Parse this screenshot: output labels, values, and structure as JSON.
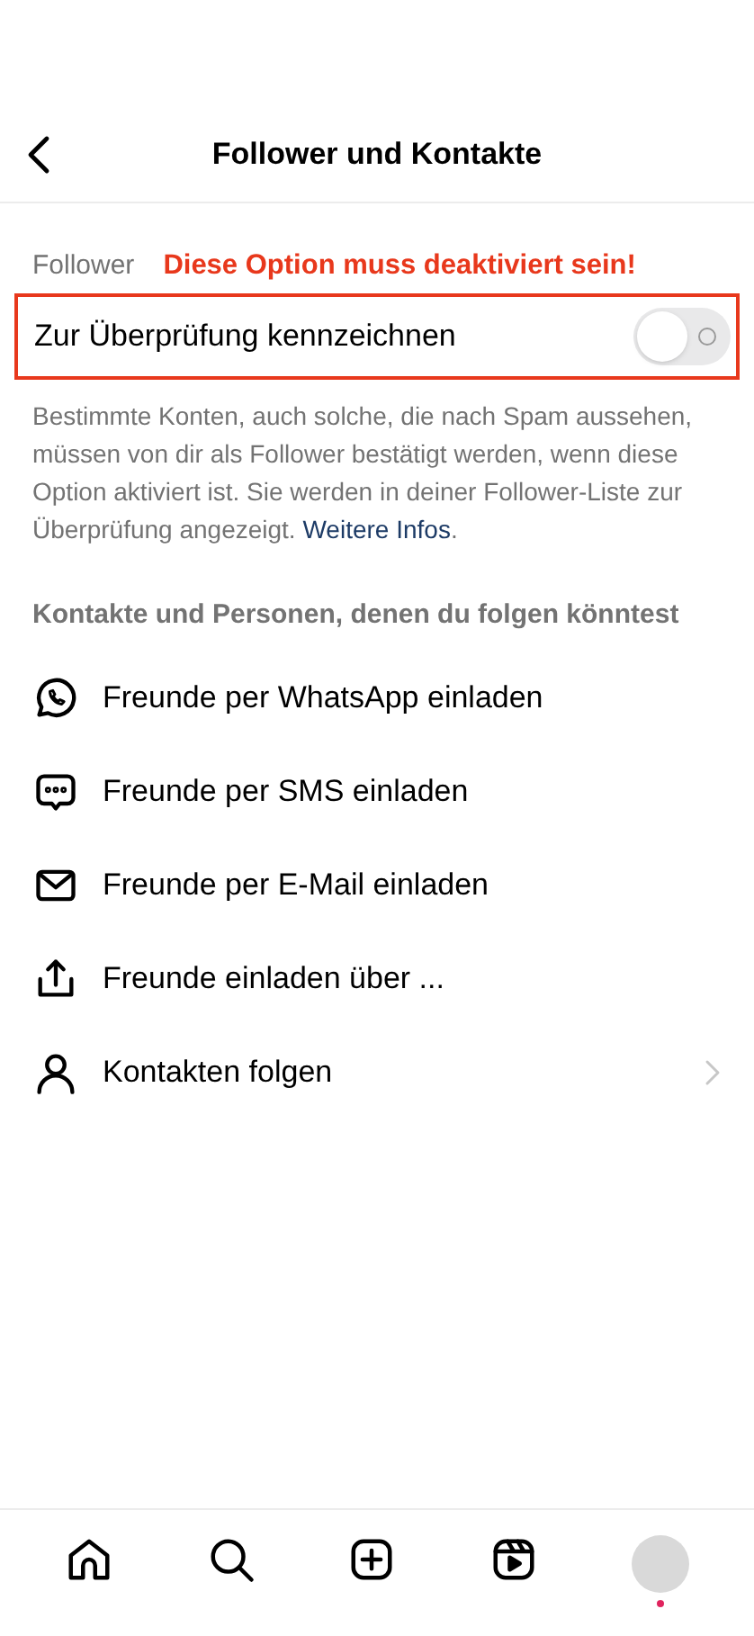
{
  "header": {
    "title": "Follower und Kontakte"
  },
  "follower_section": {
    "label": "Follower",
    "annotation": "Diese Option muss deaktiviert sein!",
    "toggle": {
      "label": "Zur Überprüfung kennzeichnen",
      "on": false
    },
    "description": "Bestimmte Konten, auch solche, die nach Spam aussehen, müssen von dir als Follower bestätigt werden, wenn diese Option aktiviert ist. Sie werden in deiner Follower-Liste zur Überprüfung angezeigt.",
    "link": "Weitere Infos",
    "link_suffix": "."
  },
  "contacts_section": {
    "label": "Kontakte und Personen, denen du folgen könntest",
    "items": [
      {
        "kind": "whatsapp",
        "label": "Freunde per WhatsApp einladen",
        "chevron": false
      },
      {
        "kind": "sms",
        "label": "Freunde per SMS einladen",
        "chevron": false
      },
      {
        "kind": "email",
        "label": "Freunde per E-Mail einladen",
        "chevron": false
      },
      {
        "kind": "share",
        "label": "Freunde einladen über ...",
        "chevron": false
      },
      {
        "kind": "person",
        "label": "Kontakten folgen",
        "chevron": true
      }
    ]
  },
  "bottom_nav": {
    "profile_notification": true
  }
}
